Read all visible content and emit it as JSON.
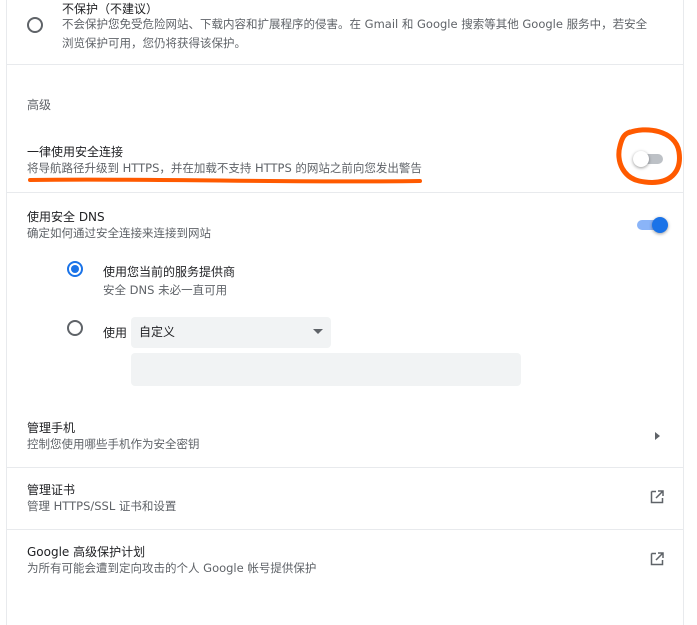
{
  "no_protection": {
    "title": "不保护（不建议）",
    "desc_line1": "不会保护您免受危险网站、下载内容和扩展程序的侵害。在 Gmail 和 Google 搜索等其他 Google 服务中，若安全",
    "desc_line2": "浏览保护可用，您仍将获得该保护。"
  },
  "advanced": {
    "heading": "高级"
  },
  "always_https": {
    "title": "一律使用安全连接",
    "desc": "将导航路径升级到 HTTPS，并在加载不支持 HTTPS 的网站之前向您发出警告",
    "enabled": false
  },
  "secure_dns": {
    "title": "使用安全 DNS",
    "desc": "确定如何通过安全连接来连接到网站",
    "enabled": true,
    "option_current": {
      "label": "使用您当前的服务提供商",
      "desc": "安全 DNS 未必一直可用",
      "selected": true
    },
    "option_custom": {
      "label": "使用",
      "select_value": "自定义",
      "input_value": "",
      "selected": false
    }
  },
  "manage_phones": {
    "title": "管理手机",
    "desc": "控制您使用哪些手机作为安全密钥"
  },
  "manage_certs": {
    "title": "管理证书",
    "desc": "管理 HTTPS/SSL 证书和设置"
  },
  "advanced_protection": {
    "title": "Google 高级保护计划",
    "desc": "为所有可能会遭到定向攻击的个人 Google 帐号提供保护"
  },
  "colors": {
    "accent": "#1a73e8",
    "annotation": "#ff5a00"
  }
}
